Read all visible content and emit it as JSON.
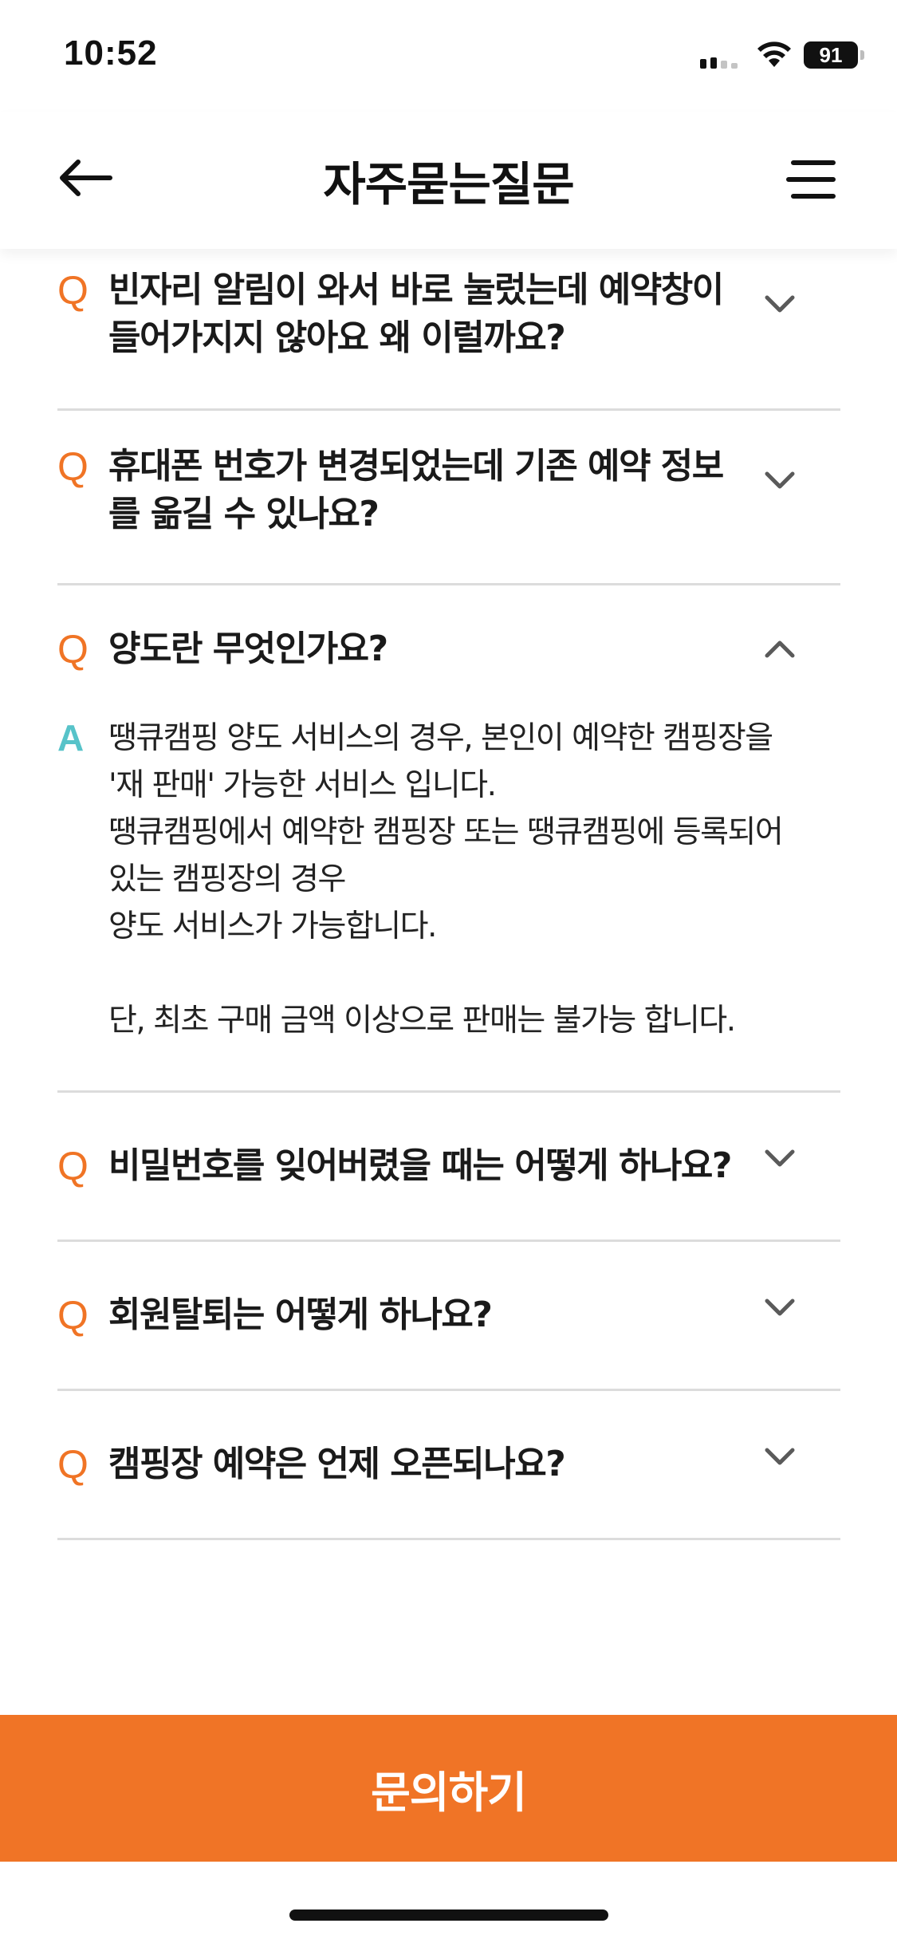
{
  "status_bar": {
    "time": "10:52",
    "battery": "91",
    "icons": [
      "signal-icon",
      "wifi-icon",
      "battery-icon"
    ]
  },
  "header": {
    "title": "자주묻는질문",
    "back_icon": "arrow-left-icon",
    "menu_icon": "menu-icon"
  },
  "colors": {
    "accent": "#f07426",
    "answer_mark": "#57c3c9",
    "divider": "#dcdcdc"
  },
  "faq": {
    "question_mark": "Q",
    "answer_mark": "A",
    "items": [
      {
        "question": "빈자리 알림이 와서 바로 눌렀는데 예약창이 들어가지지 않아요 왜 이럴까요?",
        "expanded": false
      },
      {
        "question": "휴대폰 번호가 변경되었는데 기존 예약 정보를 옮길 수 있나요?",
        "expanded": false
      },
      {
        "question": "양도란 무엇인가요?",
        "expanded": true,
        "answer": "땡큐캠핑 양도 서비스의 경우, 본인이 예약한 캠핑장을 '재 판매' 가능한 서비스 입니다.\n땡큐캠핑에서 예약한 캠핑장 또는 땡큐캠핑에 등록되어 있는 캠핑장의 경우\n양도 서비스가 가능합니다.\n\n단, 최초 구매 금액 이상으로 판매는 불가능 합니다."
      },
      {
        "question": "비밀번호를 잊어버렸을 때는 어떻게 하나요?",
        "expanded": false
      },
      {
        "question": "회원탈퇴는 어떻게 하나요?",
        "expanded": false
      },
      {
        "question": "캠핑장 예약은 언제 오픈되나요?",
        "expanded": false
      }
    ]
  },
  "footer": {
    "inquiry_label": "문의하기"
  }
}
